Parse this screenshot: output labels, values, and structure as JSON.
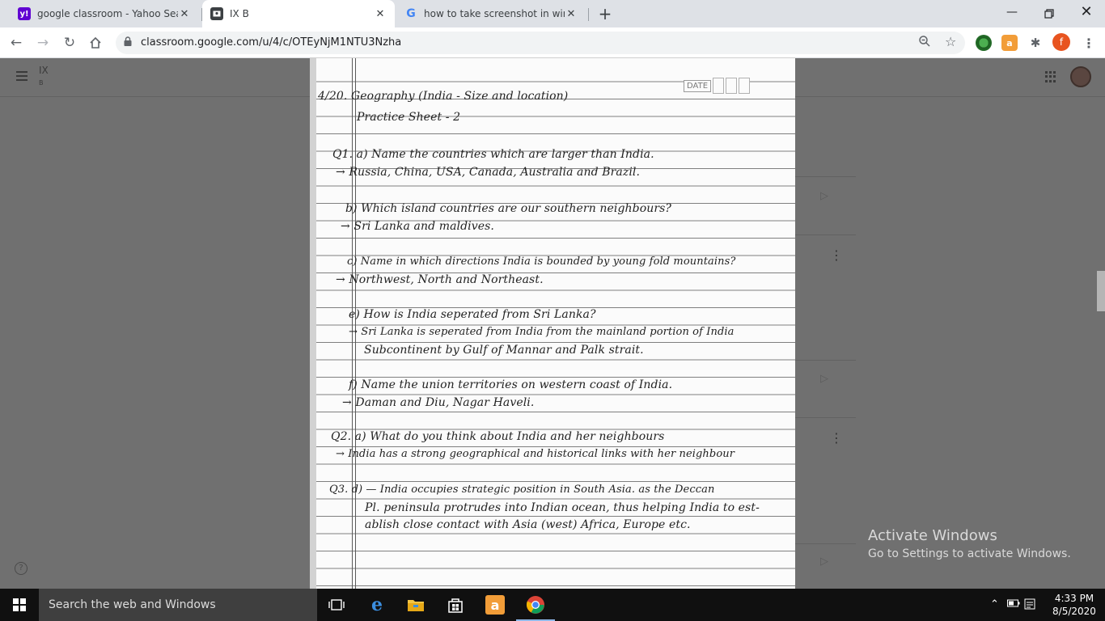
{
  "browser": {
    "tabs": [
      {
        "title": "google classroom - Yahoo Search",
        "favicon": "yahoo-icon",
        "active": false
      },
      {
        "title": "IX B",
        "favicon": "classroom-icon",
        "active": true
      },
      {
        "title": "how to take screenshot in windo",
        "favicon": "google-icon",
        "active": false
      }
    ],
    "url": "classroom.google.com/u/4/c/OTEyNjM1NTU3Nzha",
    "profile_initial": "f"
  },
  "classroom": {
    "class_title": "IX",
    "class_subtitle": "B"
  },
  "notebook": {
    "date_label": "DATE",
    "lines": [
      {
        "text": "4/20. Geography (India - Size and location)"
      },
      {
        "text": "Practice Sheet - 2"
      },
      {
        "text": "Q1. a) Name the countries which are larger than India."
      },
      {
        "text": "→  Russia, China, USA, Canada, Australia and Brazil."
      },
      {
        "text": "b) Which island countries are our southern neighbours?"
      },
      {
        "text": "→  Sri Lanka and maldives."
      },
      {
        "text": "c) Name in which directions India is bounded by young fold mountains?"
      },
      {
        "text": "→  Northwest, North and Northeast."
      },
      {
        "text": "e) How is India seperated from Sri Lanka?"
      },
      {
        "text": "→ Sri Lanka is seperated from India from the mainland portion of India"
      },
      {
        "text": "Subcontinent by Gulf of Mannar and Palk strait."
      },
      {
        "text": "f) Name the union territories on western coast of India."
      },
      {
        "text": "→  Daman and Diu, Nagar Haveli."
      },
      {
        "text": "Q2. a) What do you think about India and her neighbours"
      },
      {
        "text": "→ India has a strong geographical and historical links with her neighbour"
      },
      {
        "text": "Q3. d) — India occupies strategic position in South Asia. as the Deccan"
      },
      {
        "text": "Pl. peninsula protrudes into Indian ocean, thus helping India to est-"
      },
      {
        "text": "ablish close contact with Asia (west) Africa, Europe etc."
      }
    ]
  },
  "watermark": {
    "title": "Activate Windows",
    "subtitle": "Go to Settings to activate Windows."
  },
  "taskbar": {
    "search_placeholder": "Search the web and Windows",
    "time": "4:33 PM",
    "date": "8/5/2020"
  },
  "colors": {
    "chrome_tabstrip": "#dee1e6",
    "taskbar": "#101010",
    "profile": "#e8541f"
  }
}
